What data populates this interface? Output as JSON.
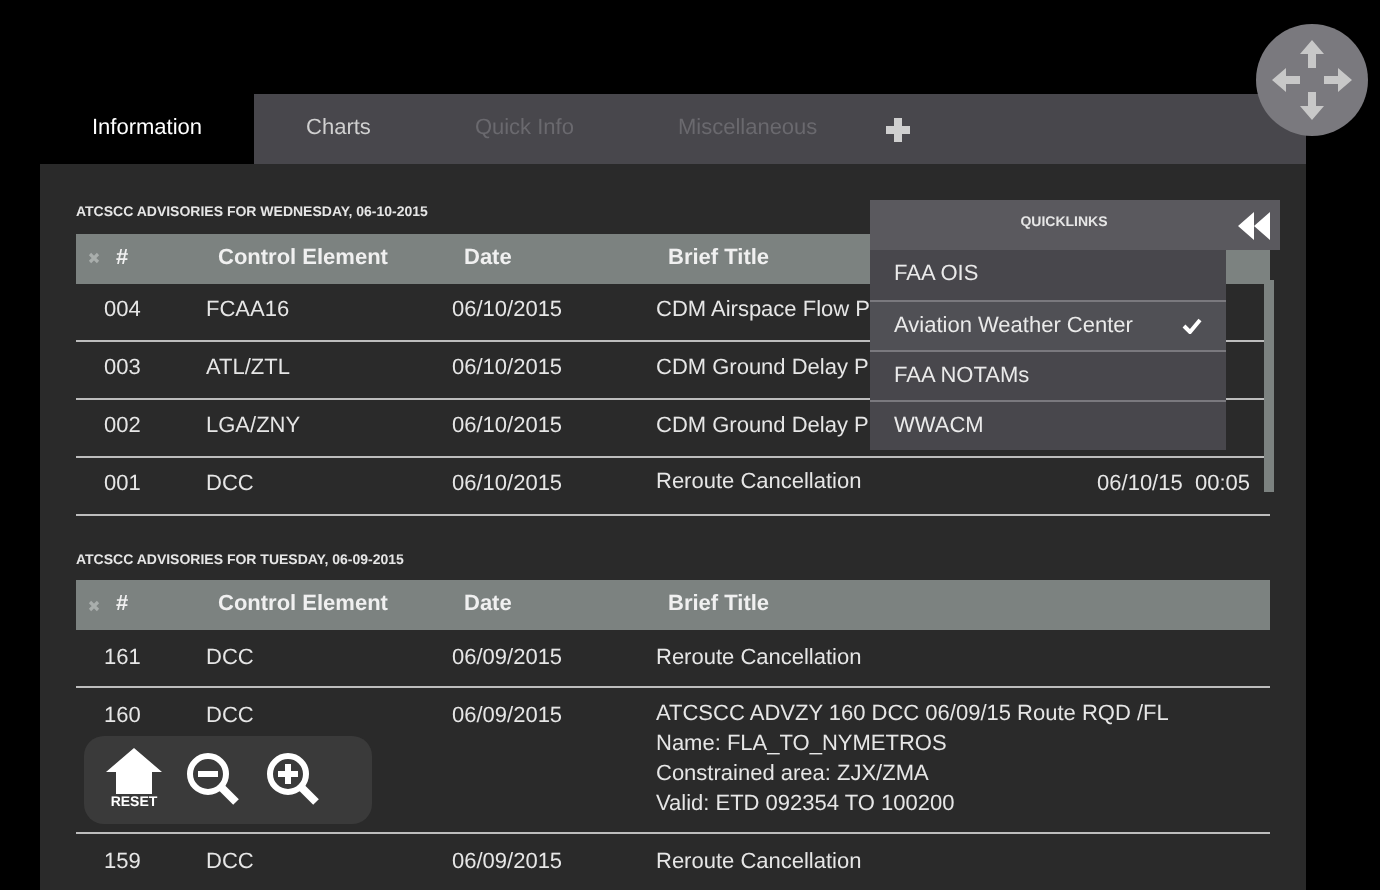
{
  "tabs": [
    {
      "label": "Information",
      "selected": true,
      "disabled": false
    },
    {
      "label": "Charts",
      "selected": false,
      "disabled": false
    },
    {
      "label": "Quick Info",
      "selected": false,
      "disabled": true
    },
    {
      "label": "Miscellaneous",
      "selected": false,
      "disabled": true
    }
  ],
  "sections": [
    {
      "title": "ATCSCC ADVISORIES FOR WEDNESDAY, 06-10-2015",
      "columns": [
        "#",
        "Control Element",
        "Date",
        "Brief Title"
      ],
      "rows": [
        {
          "number": "004",
          "element": "FCAA16",
          "date": "06/10/2015",
          "title_lines": [
            "CDM Airspace Flow P"
          ]
        },
        {
          "number": "003",
          "element": "ATL/ZTL",
          "date": "06/10/2015",
          "title_lines": [
            "CDM Ground Delay P"
          ]
        },
        {
          "number": "002",
          "element": "LGA/ZNY",
          "date": "06/10/2015",
          "title_lines": [
            "CDM Ground Delay P"
          ]
        },
        {
          "number": "001",
          "element": "DCC",
          "date": "06/10/2015",
          "title_lines": [
            "Reroute Cancellation"
          ],
          "issued": "06/10/15  00:05"
        }
      ]
    },
    {
      "title": "ATCSCC ADVISORIES FOR TUESDAY, 06-09-2015",
      "columns": [
        "#",
        "Control Element",
        "Date",
        "Brief Title"
      ],
      "rows": [
        {
          "number": "161",
          "element": "DCC",
          "date": "06/09/2015",
          "title_lines": [
            "Reroute Cancellation"
          ]
        },
        {
          "number": "160",
          "element": "DCC",
          "date": "06/09/2015",
          "title_lines": [
            "ATCSCC ADVZY 160 DCC 06/09/15 Route RQD /FL",
            "Name: FLA_TO_NYMETROS",
            "Constrained area: ZJX/ZMA",
            "Valid: ETD  092354 TO 100200"
          ]
        },
        {
          "number": "159",
          "element": "DCC",
          "date": "06/09/2015",
          "title_lines": [
            "Reroute Cancellation"
          ]
        }
      ]
    }
  ],
  "quicklinks": {
    "title": "QUICKLINKS",
    "items": [
      {
        "label": "FAA OIS",
        "selected": false
      },
      {
        "label": "Aviation Weather Center",
        "selected": true
      },
      {
        "label": "FAA NOTAMs",
        "selected": false
      },
      {
        "label": "WWACM",
        "selected": false
      }
    ]
  },
  "zoom_controls": {
    "reset_label": "RESET"
  }
}
